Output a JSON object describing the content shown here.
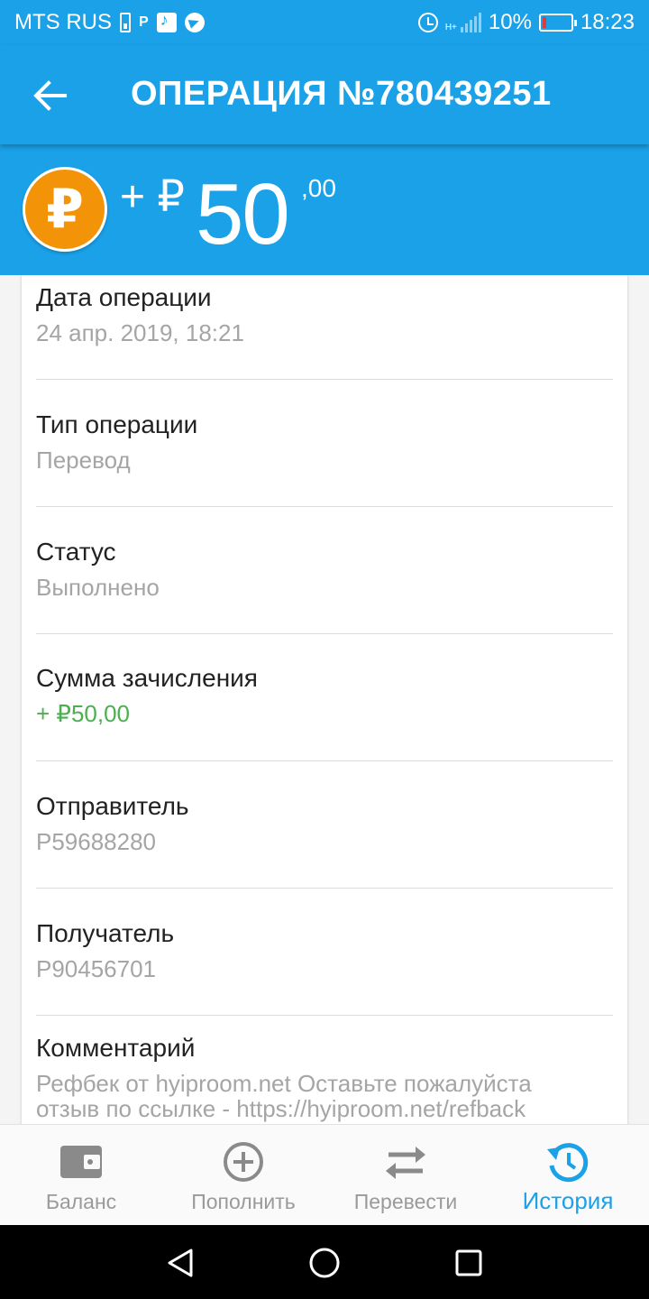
{
  "status_bar": {
    "carrier": "MTS RUS",
    "p_badge": "P",
    "network": "H+",
    "battery_percent": "10%",
    "battery_level": 0.1,
    "time": "18:23"
  },
  "app_bar": {
    "title": "ОПЕРАЦИЯ №780439251"
  },
  "amount": {
    "coin_symbol": "₽",
    "sign": "+ ₽",
    "integer": "50",
    "fraction": ",00"
  },
  "details": [
    {
      "label": "Дата операции",
      "value": "24 апр. 2019, 18:21"
    },
    {
      "label": "Тип операции",
      "value": "Перевод"
    },
    {
      "label": "Статус",
      "value": "Выполнено"
    },
    {
      "label": "Сумма зачисления",
      "value": "+ ₽50,00"
    },
    {
      "label": "Отправитель",
      "value": "P59688280"
    },
    {
      "label": "Получатель",
      "value": "P90456701"
    },
    {
      "label": "Комментарий",
      "value": "Рефбек от hyiproom.net  Оставьте пожалуйста\nотзыв по ссылке - https://hyiproom.net/refback"
    }
  ],
  "bottom_nav": {
    "items": [
      {
        "label": "Баланс",
        "icon": "wallet-icon"
      },
      {
        "label": "Пополнить",
        "icon": "plus-circle-icon"
      },
      {
        "label": "Перевести",
        "icon": "transfer-arrows-icon"
      },
      {
        "label": "История",
        "icon": "history-icon",
        "active": true
      }
    ]
  },
  "colors": {
    "primary": "#1aa1e8",
    "coin": "#f39408",
    "positive": "#4caf50"
  }
}
